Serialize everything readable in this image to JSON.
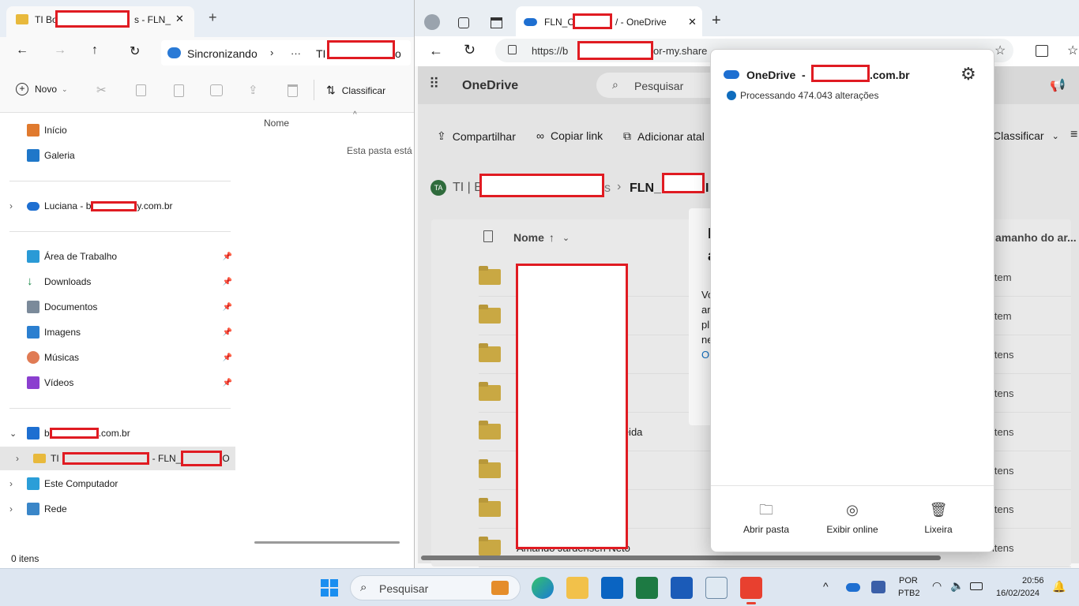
{
  "explorer": {
    "tab_title_start": "TI Bo",
    "tab_title_end": "s - FLN_",
    "close_glyph": "✕",
    "add_tab_glyph": "+",
    "sync_label": "Sincronizando",
    "breadcrumb_more": "···",
    "breadcrumb_ti": "TI",
    "breadcrumb_end": "o",
    "new_label": "Novo",
    "sort_label": "Classificar",
    "nav": {
      "home": "Início",
      "gallery": "Galeria",
      "onedrive_start": "Luciana - b",
      "onedrive_end": "y.com.br",
      "desktop": "Área de Trabalho",
      "downloads": "Downloads",
      "documents": "Documentos",
      "images": "Imagens",
      "music": "Músicas",
      "videos": "Vídeos",
      "org_start": "b",
      "org_end": ".com.br",
      "folder_start": "TI",
      "folder_mid": "- FLN_",
      "folder_end": "O",
      "this_pc": "Este Computador",
      "network": "Rede"
    },
    "column_name": "Nome",
    "empty_text": "Esta pasta está v",
    "status": "0 itens"
  },
  "edge": {
    "tab_title_start": "FLN_C",
    "tab_title_end": "/ - OneDrive",
    "url_start": "https://b",
    "url_end": "or-my.share",
    "onedrive_brand": "OneDrive",
    "search_placeholder": "Pesquisar",
    "share": "Compartilhar",
    "copy_link": "Copiar link",
    "add_shortcut": "Adicionar atal",
    "sort": "Classificar",
    "breadcrumb_avatar": "TA",
    "breadcrumb_start": "TI | B",
    "breadcrumb_s": "s",
    "breadcrumb_current": "FLN_",
    "breadcrumb_tail": "I",
    "col_name": "Nome",
    "col_size": "amanho do ar...",
    "dialog_lines": [
      "Vo",
      "ar",
      "pl",
      "ne",
      "O"
    ],
    "dialog_title": [
      "I",
      "a"
    ],
    "rows": [
      {
        "name_tail": "",
        "size": "item"
      },
      {
        "name_tail": "",
        "size": "item"
      },
      {
        "name_tail": "no",
        "size": "itens"
      },
      {
        "name_tail": "",
        "size": "itens"
      },
      {
        "name_tail": "meida",
        "size": "itens"
      },
      {
        "name_tail": "",
        "size": "itens"
      },
      {
        "name_tail": "",
        "size": "itens"
      },
      {
        "name_tail": "Amando Jardensen Neto",
        "size": "itens"
      }
    ]
  },
  "flyout": {
    "title_start": "OneDrive  -  b",
    "title_end": ".com.br",
    "status": "Processando 474.043 alterações",
    "open_folder": "Abrir pasta",
    "view_online": "Exibir online",
    "recycle": "Lixeira"
  },
  "taskbar": {
    "search": "Pesquisar",
    "lang_top": "POR",
    "lang_bottom": "PTB2",
    "time": "20:56",
    "date": "16/02/2024"
  },
  "colors": {
    "accent_blue": "#0f6cbd",
    "redaction": "#e01b22",
    "folder_yellow": "#c9a843"
  }
}
